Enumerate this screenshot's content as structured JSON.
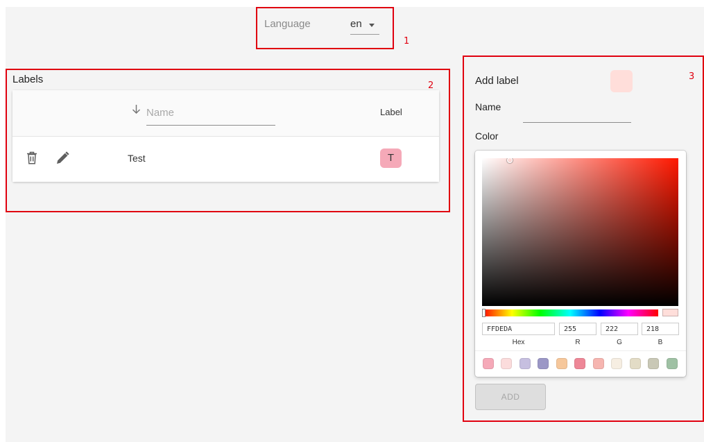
{
  "annotations": [
    "1",
    "2",
    "3"
  ],
  "language": {
    "label": "Language",
    "value": "en"
  },
  "labels_panel": {
    "title": "Labels",
    "table": {
      "name_filter_placeholder": "Name",
      "label_column": "Label",
      "rows": [
        {
          "name": "Test",
          "chip_text": "T",
          "chip_color": "#f5a9b8"
        }
      ]
    }
  },
  "add_label": {
    "title": "Add label",
    "name_field_label": "Name",
    "name_value": "",
    "color_field_label": "Color",
    "preview_color": "#FFDEDA",
    "picker": {
      "hex_value": "FFDEDA",
      "r_value": "255",
      "g_value": "222",
      "b_value": "218",
      "hex_caption": "Hex",
      "r_caption": "R",
      "g_caption": "G",
      "b_caption": "B",
      "swatches": [
        "#f5a9b8",
        "#fbdcdc",
        "#c6bfe0",
        "#9b97c6",
        "#f6c79b",
        "#ee8797",
        "#f6b5b0",
        "#f6eee2",
        "#e3dcc6",
        "#c9c8b6",
        "#9fc1a4"
      ]
    },
    "add_button_label": "ADD"
  }
}
